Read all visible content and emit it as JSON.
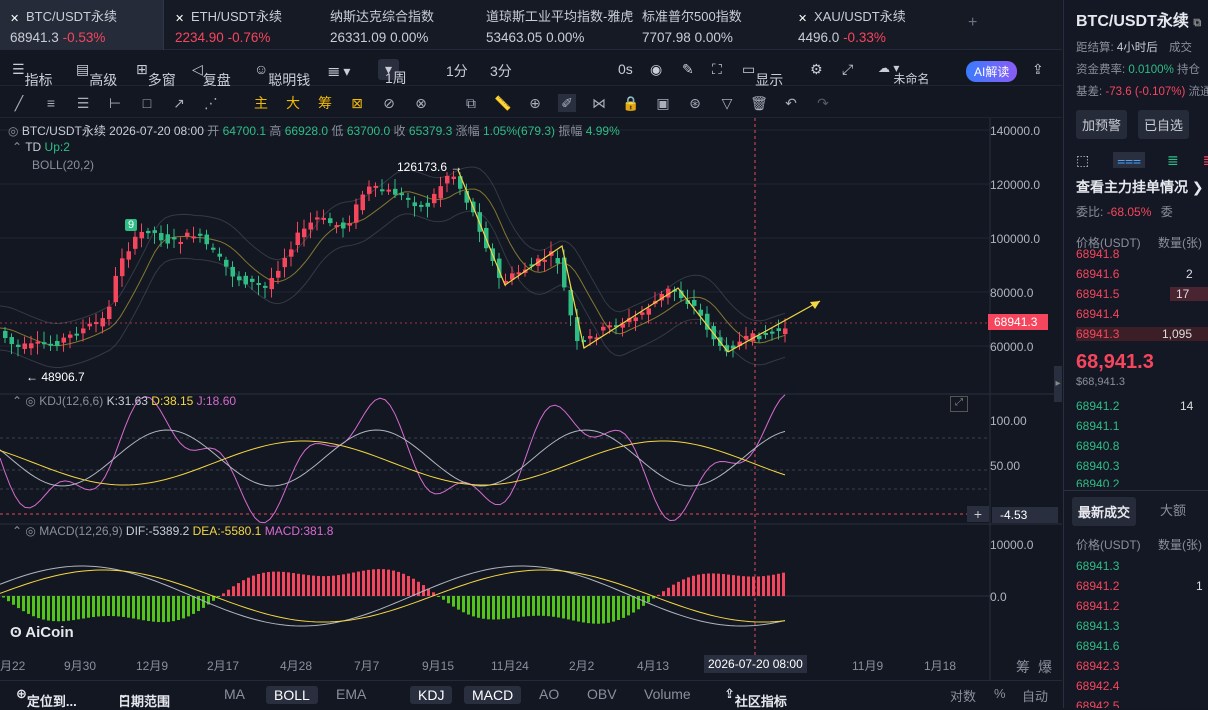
{
  "tickers": [
    {
      "name": "BTC/USDT永续",
      "price": "68941.3",
      "change": "-0.53%",
      "dir": "dn"
    },
    {
      "name": "ETH/USDT永续",
      "price": "2234.90",
      "change": "-0.76%",
      "dir": "dn"
    },
    {
      "name": "纳斯达克综合指数",
      "price": "26331.09",
      "change": "0.00%",
      "dir": "up"
    },
    {
      "name": "道琼斯工业平均指数-雅虎",
      "price": "53463.05",
      "change": "0.00%",
      "dir": "up"
    },
    {
      "name": "标准普尔500指数",
      "price": "7707.98",
      "change": "0.00%",
      "dir": "up"
    },
    {
      "name": "XAU/USDT永续",
      "price": "4496.0",
      "change": "-0.33%",
      "dir": "dn"
    }
  ],
  "toolbar": {
    "indicators": "指标",
    "advanced": "高级",
    "multiwin": "多窗",
    "replay": "复盘",
    "smartmoney": "聪明钱",
    "period": "1周",
    "p1": "1分",
    "p2": "3分",
    "zero": "0s",
    "display": "显示",
    "community": "社区",
    "layout": "未命名",
    "ai": "AI解读"
  },
  "drawtools": {
    "main": "主",
    "big": "大",
    "chip": "筹"
  },
  "chart": {
    "info": "BTC/USDT永续 2026-07-20 08:00",
    "open_l": "开",
    "open": "64700.1",
    "high_l": "高",
    "high": "66928.0",
    "low_l": "低",
    "low": "63700.0",
    "close_l": "收",
    "close": "65379.3",
    "chg_l": "涨幅",
    "chg": "1.05%(679.3)",
    "amp_l": "振幅",
    "amp": "4.99%",
    "td": "TD",
    "td_up": "Up:2",
    "boll": "BOLL(20,2)",
    "hi_mark": "126173.6 →",
    "lo_mark": "← 48906.7",
    "td_count": "9",
    "price_ticks": [
      "140000.0",
      "120000.0",
      "100000.0",
      "80000.0",
      "60000.0"
    ],
    "last_price": "68941.3",
    "kdj_label": "KDJ(12,6,6)",
    "kdj_k": "K:31.63",
    "kdj_d": "D:38.15",
    "kdj_j": "J:18.60",
    "kdj_ticks": [
      "100.00",
      "50.00"
    ],
    "kdj_cursor": "-4.53",
    "macd_label": "MACD(12,26,9)",
    "macd_dif": "DIF:-5389.2",
    "macd_dea": "DEA:-5580.1",
    "macd_val": "MACD:381.8",
    "macd_ticks": [
      "10000.0",
      "0.0"
    ],
    "dates": [
      "月22",
      "9月30",
      "12月9",
      "2月17",
      "4月28",
      "7月7",
      "9月15",
      "11月24",
      "2月2",
      "4月13",
      "2026-07-20 08:00",
      "11月9",
      "1月18"
    ],
    "logo": "AiCoin"
  },
  "bottom": {
    "locate": "定位到...",
    "range": "日期范围",
    "ma": "MA",
    "boll": "BOLL",
    "ema": "EMA",
    "kdj": "KDJ",
    "macd": "MACD",
    "ao": "AO",
    "obv": "OBV",
    "volume": "Volume",
    "community": "社区指标",
    "log": "对数",
    "pct": "%",
    "auto": "自动",
    "chip": "筹",
    "burst": "爆"
  },
  "right": {
    "title": "BTC/USDT永续",
    "settle_l": "距结算:",
    "settle": "4小时后",
    "deal": "成交",
    "fund_l": "资金费率:",
    "fund": "0.0100%",
    "hold": "持仓",
    "basis_l": "基差:",
    "basis": "-73.6 (-0.107%)",
    "flow": "流通",
    "alert": "加预警",
    "selected": "已自选",
    "orders_title": "查看主力挂单情况 ❯",
    "ratio_l": "委比:",
    "ratio": "-68.05%",
    "ratio_r": "委",
    "col_price": "价格(USDT)",
    "col_qty": "数量(张)",
    "asks": [
      {
        "p": "68941.8",
        "q": ""
      },
      {
        "p": "68941.6",
        "q": "2"
      },
      {
        "p": "68941.5",
        "q": "17"
      },
      {
        "p": "68941.4",
        "q": ""
      },
      {
        "p": "68941.3",
        "q": "1,095"
      }
    ],
    "mid": "68,941.3",
    "mid_sub": "$68,941.3",
    "bids": [
      {
        "p": "68941.2",
        "q": "14"
      },
      {
        "p": "68941.1",
        "q": ""
      },
      {
        "p": "68940.8",
        "q": ""
      },
      {
        "p": "68940.3",
        "q": ""
      },
      {
        "p": "68940.2",
        "q": ""
      }
    ],
    "tab_latest": "最新成交",
    "tab_big": "大额",
    "trades": [
      {
        "p": "68941.3",
        "q": "",
        "d": "up"
      },
      {
        "p": "68941.2",
        "q": "1",
        "d": "dn"
      },
      {
        "p": "68941.2",
        "q": "",
        "d": "dn"
      },
      {
        "p": "68941.3",
        "q": "",
        "d": "up"
      },
      {
        "p": "68941.6",
        "q": "",
        "d": "up"
      },
      {
        "p": "68942.3",
        "q": "",
        "d": "dn"
      },
      {
        "p": "68942.4",
        "q": "",
        "d": "dn"
      },
      {
        "p": "68942.5",
        "q": "",
        "d": "dn"
      }
    ]
  },
  "colors": {
    "up": "#f6465d",
    "down": "#2ebd85",
    "accent": "#f0b90b",
    "boll": "#f5d742"
  }
}
